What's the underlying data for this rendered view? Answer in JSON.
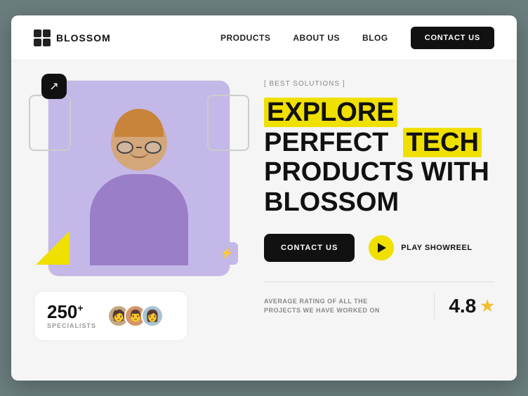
{
  "browser": {
    "bg": "#6b7d7d"
  },
  "navbar": {
    "logo_text": "BLOSSOM",
    "nav_items": [
      {
        "label": "PRODUCTS",
        "id": "products"
      },
      {
        "label": "ABOUT US",
        "id": "about"
      },
      {
        "label": "BLOG",
        "id": "blog"
      }
    ],
    "contact_button": "CONTACT US"
  },
  "hero": {
    "tagline": "[ BEST SOLUTIONS ]",
    "headline_part1": "EXPLORE",
    "headline_part2": "PERFECT",
    "headline_highlight2": "TECH",
    "headline_part3": "PRODUCTS WITH",
    "headline_part4": "BLOSSOM",
    "cta_label": "CONTACT US",
    "play_label": "PLAY SHOWREEL"
  },
  "stats": {
    "specialists_number": "250",
    "specialists_sup": "+",
    "specialists_label": "SPECIALISTS"
  },
  "rating": {
    "description_line1": "AVERAGE RATING OF ALL THE",
    "description_line2": "PROJECTS WE HAVE WORKED ON",
    "value": "4.8"
  },
  "icons": {
    "arrow_icon": "↗",
    "flash_icon": "⚡",
    "play_icon": "▶",
    "star_icon": "★"
  }
}
